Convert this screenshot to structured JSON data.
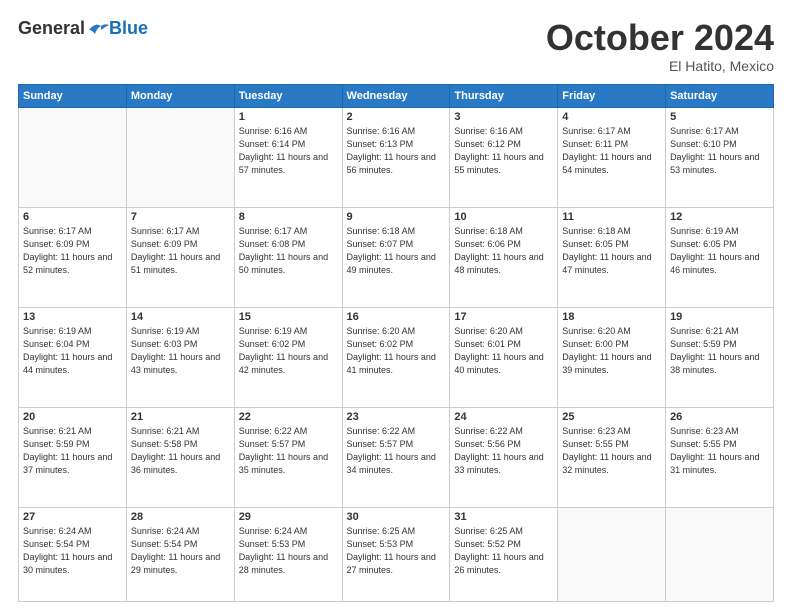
{
  "header": {
    "logo_general": "General",
    "logo_blue": "Blue",
    "month_title": "October 2024",
    "location": "El Hatito, Mexico"
  },
  "days_of_week": [
    "Sunday",
    "Monday",
    "Tuesday",
    "Wednesday",
    "Thursday",
    "Friday",
    "Saturday"
  ],
  "weeks": [
    [
      {
        "day": "",
        "info": ""
      },
      {
        "day": "",
        "info": ""
      },
      {
        "day": "1",
        "info": "Sunrise: 6:16 AM\nSunset: 6:14 PM\nDaylight: 11 hours and 57 minutes."
      },
      {
        "day": "2",
        "info": "Sunrise: 6:16 AM\nSunset: 6:13 PM\nDaylight: 11 hours and 56 minutes."
      },
      {
        "day": "3",
        "info": "Sunrise: 6:16 AM\nSunset: 6:12 PM\nDaylight: 11 hours and 55 minutes."
      },
      {
        "day": "4",
        "info": "Sunrise: 6:17 AM\nSunset: 6:11 PM\nDaylight: 11 hours and 54 minutes."
      },
      {
        "day": "5",
        "info": "Sunrise: 6:17 AM\nSunset: 6:10 PM\nDaylight: 11 hours and 53 minutes."
      }
    ],
    [
      {
        "day": "6",
        "info": "Sunrise: 6:17 AM\nSunset: 6:09 PM\nDaylight: 11 hours and 52 minutes."
      },
      {
        "day": "7",
        "info": "Sunrise: 6:17 AM\nSunset: 6:09 PM\nDaylight: 11 hours and 51 minutes."
      },
      {
        "day": "8",
        "info": "Sunrise: 6:17 AM\nSunset: 6:08 PM\nDaylight: 11 hours and 50 minutes."
      },
      {
        "day": "9",
        "info": "Sunrise: 6:18 AM\nSunset: 6:07 PM\nDaylight: 11 hours and 49 minutes."
      },
      {
        "day": "10",
        "info": "Sunrise: 6:18 AM\nSunset: 6:06 PM\nDaylight: 11 hours and 48 minutes."
      },
      {
        "day": "11",
        "info": "Sunrise: 6:18 AM\nSunset: 6:05 PM\nDaylight: 11 hours and 47 minutes."
      },
      {
        "day": "12",
        "info": "Sunrise: 6:19 AM\nSunset: 6:05 PM\nDaylight: 11 hours and 46 minutes."
      }
    ],
    [
      {
        "day": "13",
        "info": "Sunrise: 6:19 AM\nSunset: 6:04 PM\nDaylight: 11 hours and 44 minutes."
      },
      {
        "day": "14",
        "info": "Sunrise: 6:19 AM\nSunset: 6:03 PM\nDaylight: 11 hours and 43 minutes."
      },
      {
        "day": "15",
        "info": "Sunrise: 6:19 AM\nSunset: 6:02 PM\nDaylight: 11 hours and 42 minutes."
      },
      {
        "day": "16",
        "info": "Sunrise: 6:20 AM\nSunset: 6:02 PM\nDaylight: 11 hours and 41 minutes."
      },
      {
        "day": "17",
        "info": "Sunrise: 6:20 AM\nSunset: 6:01 PM\nDaylight: 11 hours and 40 minutes."
      },
      {
        "day": "18",
        "info": "Sunrise: 6:20 AM\nSunset: 6:00 PM\nDaylight: 11 hours and 39 minutes."
      },
      {
        "day": "19",
        "info": "Sunrise: 6:21 AM\nSunset: 5:59 PM\nDaylight: 11 hours and 38 minutes."
      }
    ],
    [
      {
        "day": "20",
        "info": "Sunrise: 6:21 AM\nSunset: 5:59 PM\nDaylight: 11 hours and 37 minutes."
      },
      {
        "day": "21",
        "info": "Sunrise: 6:21 AM\nSunset: 5:58 PM\nDaylight: 11 hours and 36 minutes."
      },
      {
        "day": "22",
        "info": "Sunrise: 6:22 AM\nSunset: 5:57 PM\nDaylight: 11 hours and 35 minutes."
      },
      {
        "day": "23",
        "info": "Sunrise: 6:22 AM\nSunset: 5:57 PM\nDaylight: 11 hours and 34 minutes."
      },
      {
        "day": "24",
        "info": "Sunrise: 6:22 AM\nSunset: 5:56 PM\nDaylight: 11 hours and 33 minutes."
      },
      {
        "day": "25",
        "info": "Sunrise: 6:23 AM\nSunset: 5:55 PM\nDaylight: 11 hours and 32 minutes."
      },
      {
        "day": "26",
        "info": "Sunrise: 6:23 AM\nSunset: 5:55 PM\nDaylight: 11 hours and 31 minutes."
      }
    ],
    [
      {
        "day": "27",
        "info": "Sunrise: 6:24 AM\nSunset: 5:54 PM\nDaylight: 11 hours and 30 minutes."
      },
      {
        "day": "28",
        "info": "Sunrise: 6:24 AM\nSunset: 5:54 PM\nDaylight: 11 hours and 29 minutes."
      },
      {
        "day": "29",
        "info": "Sunrise: 6:24 AM\nSunset: 5:53 PM\nDaylight: 11 hours and 28 minutes."
      },
      {
        "day": "30",
        "info": "Sunrise: 6:25 AM\nSunset: 5:53 PM\nDaylight: 11 hours and 27 minutes."
      },
      {
        "day": "31",
        "info": "Sunrise: 6:25 AM\nSunset: 5:52 PM\nDaylight: 11 hours and 26 minutes."
      },
      {
        "day": "",
        "info": ""
      },
      {
        "day": "",
        "info": ""
      }
    ]
  ]
}
